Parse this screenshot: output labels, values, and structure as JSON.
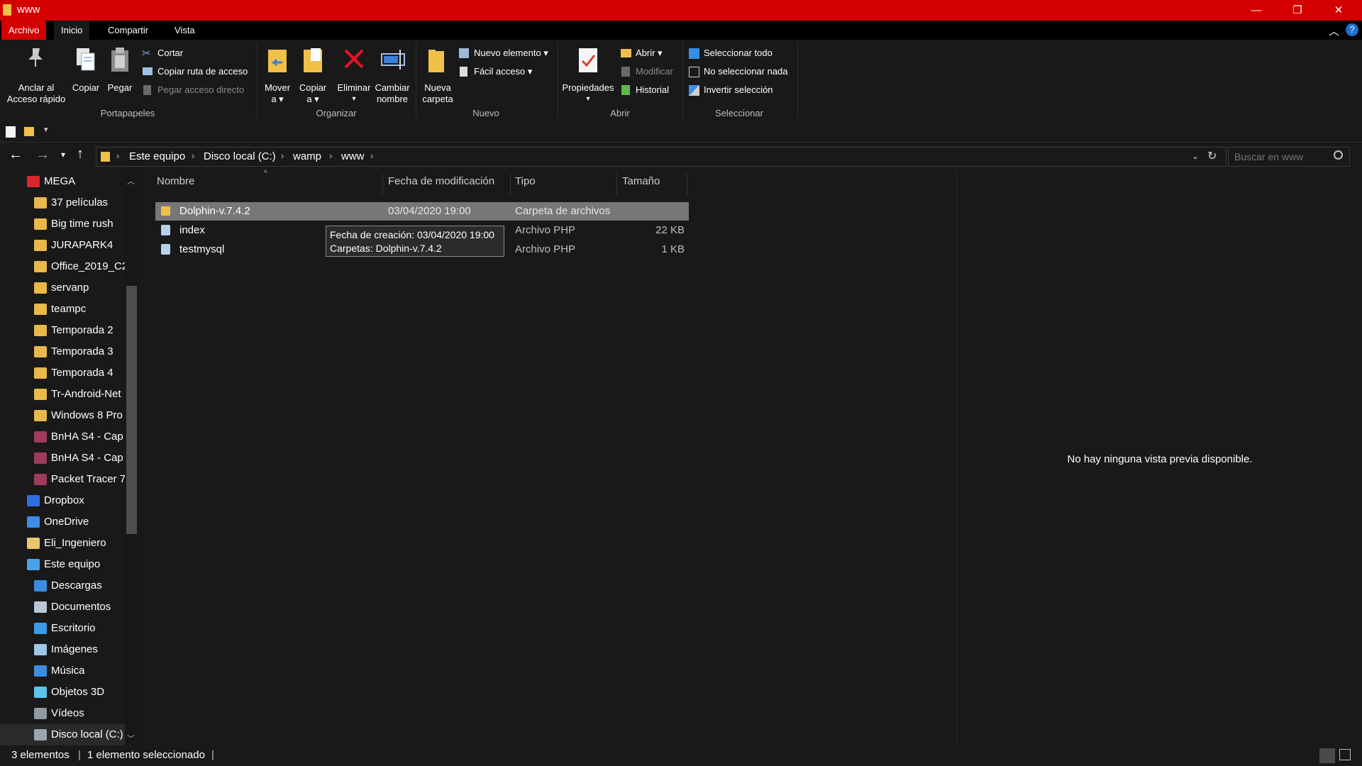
{
  "window": {
    "title": "www",
    "minimize_glyph": "—",
    "maximize_glyph": "❐",
    "close_glyph": "✕"
  },
  "menu": {
    "tabs": [
      "Archivo",
      "Inicio",
      "Compartir",
      "Vista"
    ],
    "help_glyph": "?"
  },
  "ribbon": {
    "portapapeles": {
      "group": "Portapapeles",
      "pin_line1": "Anclar al",
      "pin_line2": "Acceso rápido",
      "copy": "Copiar",
      "paste": "Pegar",
      "cut": "Cortar",
      "copy_path": "Copiar ruta de acceso",
      "paste_shortcut": "Pegar acceso directo"
    },
    "organizar": {
      "group": "Organizar",
      "move_line1": "Mover",
      "move_line2": "a ▾",
      "copy_line1": "Copiar",
      "copy_line2": "a ▾",
      "delete": "Eliminar",
      "rename_line1": "Cambiar",
      "rename_line2": "nombre"
    },
    "nuevo": {
      "group": "Nuevo",
      "new_folder_line1": "Nueva",
      "new_folder_line2": "carpeta",
      "new_item": "Nuevo elemento ▾",
      "easy_access": "Fácil acceso ▾"
    },
    "abrir": {
      "group": "Abrir",
      "properties": "Propiedades",
      "open": "Abrir ▾",
      "edit": "Modificar",
      "history": "Historial"
    },
    "seleccionar": {
      "group": "Seleccionar",
      "select_all": "Seleccionar todo",
      "select_none": "No seleccionar nada",
      "invert": "Invertir selección"
    }
  },
  "address": {
    "crumbs": [
      "Este equipo",
      "Disco local (C:)",
      "wamp",
      "www"
    ],
    "search_placeholder": "Buscar en www"
  },
  "nav": {
    "items": [
      {
        "label": "MEGA",
        "icon": "mega-icon",
        "color": "#d9272e",
        "indent": 0
      },
      {
        "label": "37 películas",
        "icon": "folder-icon",
        "color": "#e8b84a",
        "indent": 1
      },
      {
        "label": "Big time rush",
        "icon": "folder-icon",
        "color": "#e8b84a",
        "indent": 1
      },
      {
        "label": "JURAPARK4",
        "icon": "folder-icon",
        "color": "#e8b84a",
        "indent": 1
      },
      {
        "label": "Office_2019_C2",
        "icon": "folder-icon",
        "color": "#e8b84a",
        "indent": 1
      },
      {
        "label": "servanp",
        "icon": "folder-icon",
        "color": "#e8b84a",
        "indent": 1
      },
      {
        "label": "teampc",
        "icon": "folder-icon",
        "color": "#e8b84a",
        "indent": 1
      },
      {
        "label": "Temporada 2",
        "icon": "folder-icon",
        "color": "#e8b84a",
        "indent": 1
      },
      {
        "label": "Temporada 3",
        "icon": "folder-icon",
        "color": "#e8b84a",
        "indent": 1
      },
      {
        "label": "Temporada 4",
        "icon": "folder-icon",
        "color": "#e8b84a",
        "indent": 1
      },
      {
        "label": "Tr-Android-Net",
        "icon": "folder-icon",
        "color": "#e8b84a",
        "indent": 1
      },
      {
        "label": "Windows 8 Pro",
        "icon": "folder-icon",
        "color": "#e8b84a",
        "indent": 1
      },
      {
        "label": "BnHA S4 - Cap",
        "icon": "archive-icon",
        "color": "#9c3b5a",
        "indent": 1
      },
      {
        "label": "BnHA S4 - Cap",
        "icon": "archive-icon",
        "color": "#9c3b5a",
        "indent": 1
      },
      {
        "label": "Packet Tracer 7",
        "icon": "archive-icon",
        "color": "#9c3b5a",
        "indent": 1
      },
      {
        "label": "Dropbox",
        "icon": "dropbox-icon",
        "color": "#2f6fe0",
        "indent": 0
      },
      {
        "label": "OneDrive",
        "icon": "onedrive-icon",
        "color": "#3a8ee6",
        "indent": 0
      },
      {
        "label": "Eli_Ingeniero",
        "icon": "user-folder-icon",
        "color": "#e8c66a",
        "indent": 0
      },
      {
        "label": "Este equipo",
        "icon": "computer-icon",
        "color": "#4aa3e8",
        "indent": 0
      },
      {
        "label": "Descargas",
        "icon": "download-icon",
        "color": "#3b8de0",
        "indent": 1
      },
      {
        "label": "Documentos",
        "icon": "documents-icon",
        "color": "#b9c7d6",
        "indent": 1
      },
      {
        "label": "Escritorio",
        "icon": "desktop-icon",
        "color": "#3b9be6",
        "indent": 1
      },
      {
        "label": "Imágenes",
        "icon": "pictures-icon",
        "color": "#9fc5e8",
        "indent": 1
      },
      {
        "label": "Música",
        "icon": "music-icon",
        "color": "#3b8de0",
        "indent": 1
      },
      {
        "label": "Objetos 3D",
        "icon": "objects-3d-icon",
        "color": "#5ec3e8",
        "indent": 1
      },
      {
        "label": "Vídeos",
        "icon": "videos-icon",
        "color": "#8f9aa6",
        "indent": 1
      },
      {
        "label": "Disco local (C:)",
        "icon": "drive-icon",
        "color": "#9aa6b2",
        "indent": 1
      }
    ]
  },
  "list": {
    "columns": [
      "Nombre",
      "Fecha de modificación",
      "Tipo",
      "Tamaño"
    ],
    "rows": [
      {
        "name": "Dolphin-v.7.4.2",
        "date": "03/04/2020 19:00",
        "type": "Carpeta de archivos",
        "size": ""
      },
      {
        "name": "index",
        "date": "",
        "type": "Archivo PHP",
        "size": "22 KB"
      },
      {
        "name": "testmysql",
        "date": "",
        "type": "Archivo PHP",
        "size": "1 KB"
      }
    ],
    "tooltip": {
      "line1": "Fecha de creación: 03/04/2020 19:00",
      "line2": "Carpetas: Dolphin-v.7.4.2"
    }
  },
  "preview": {
    "message": "No hay ninguna vista previa disponible."
  },
  "status": {
    "count": "3 elementos",
    "selection": "1 elemento seleccionado"
  },
  "colors": {
    "titlebar": "#d40000",
    "background": "#191919",
    "selected_row": "#777777"
  }
}
